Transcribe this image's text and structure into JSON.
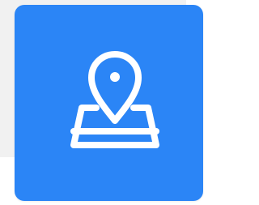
{
  "tile": {
    "background_color": "#2b85f6",
    "page_background_color": "#f1f1f1",
    "icon": {
      "name": "map-location-pin-icon",
      "color": "#ffffff"
    }
  }
}
